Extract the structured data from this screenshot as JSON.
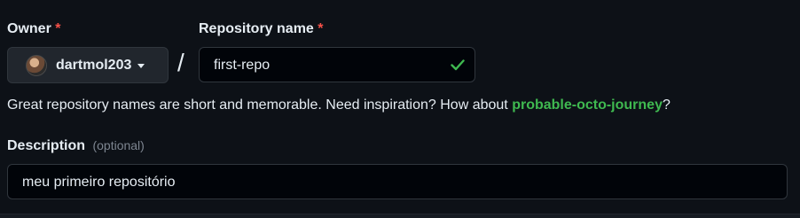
{
  "owner": {
    "label": "Owner",
    "required_marker": "*",
    "selected_user": "dartmol203"
  },
  "separator": "/",
  "repository": {
    "label": "Repository name",
    "required_marker": "*",
    "value": "first-repo",
    "status_icon": "check-icon"
  },
  "hint": {
    "text_before": "Great repository names are short and memorable. Need inspiration? How about ",
    "suggestion": "probable-octo-journey",
    "text_after": "?"
  },
  "description": {
    "label": "Description",
    "optional_text": "(optional)",
    "value": "meu primeiro repositório"
  },
  "colors": {
    "background": "#0d1117",
    "required": "#f85149",
    "success": "#3fb950",
    "muted": "#7d8590"
  }
}
